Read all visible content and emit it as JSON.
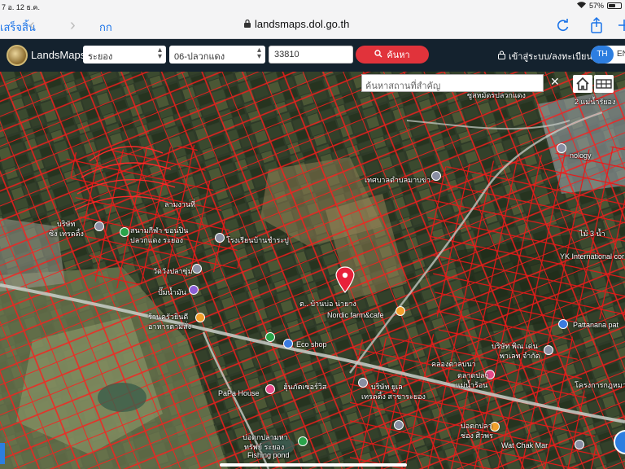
{
  "status_bar": {
    "time": "7  อ. 12 ธ.ค.",
    "battery": "57%",
    "battery_level": 0.57
  },
  "safari": {
    "back_label": "เสร็จสิ้น",
    "text_size_label": "กก",
    "url": "landsmaps.dol.go.th"
  },
  "app": {
    "brand": "LandsMaps"
  },
  "search": {
    "province": "ระยอง",
    "district": "06-ปลวกแดง",
    "postcode": "33810",
    "search_label": "ค้นหา",
    "place_placeholder": "ค้นหาสถานที่สำคัญ"
  },
  "auth": {
    "login_label": "เข้าสู่ระบบ/ลงทะเบียน"
  },
  "language": {
    "active": "TH",
    "other": "EN"
  },
  "map": {
    "labels": [
      "ซูสหมัดรปลวกแดง",
      "2 แม่น้ำรัยอง",
      "เทศบาลตำบลมาบข่า",
      "ลามงานที่",
      "บริษัท",
      "ซิง เทรดดิ้ง",
      "สนามกีฬา ขอนปิน",
      "ปลวกแดง ระยอง",
      "โรงเรียนบ้านชำระปู",
      "วัดวังปลาซุ่ม",
      "ปั๊มน้ำมัน",
      "ต.. บ้านบ่อ น่ายาง",
      "Nordic farm&cafe",
      "ร้านครัวยินดี",
      "อาหารตามสั่ง",
      "Eco shop",
      "PaPa House",
      "ฮุ้นภัตเซอร์วิส",
      "บริษัท ยูเล",
      "เทรดดิ้ง สาขาระยอง",
      "บ่อตกปลามหา",
      "ทรัพย์ ระยอง",
      "Fishing pond",
      "Wat Chak Mar",
      "Pattanana pat",
      "YK International cor",
      "บริษัท พิณ เด่น",
      "พาเลท จำกัด",
      "โครงการกฎหมาย",
      "ตลาดปลา",
      "แม่น้ำร้อน",
      "คลองตาลบนา",
      "ช่อง ศิวพร",
      "บ่อตกปลา",
      "ทรัพย์ ระยอง",
      "nology",
      "ไม้ 3 น้ำ"
    ]
  }
}
